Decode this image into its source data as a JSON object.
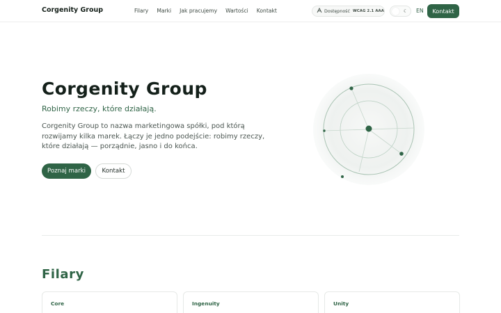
{
  "header": {
    "brand": "Corgenity Group",
    "nav": [
      "Filary",
      "Marki",
      "Jak pracujemy",
      "Wartości",
      "Kontakt"
    ],
    "accessibility_label": "Dostępność",
    "accessibility_badge": "WCAG 2.1 AAA",
    "theme_icon": "moon-icon",
    "language": "EN",
    "contact_button": "Kontakt"
  },
  "hero": {
    "title": "Corgenity Group",
    "subtitle": "Robimy rzeczy, które działają.",
    "description": "Corgenity Group to nazwa marketingowa spółki, pod którą rozwijamy kilka marek. Łączy je jedno podejście: robimy rzeczy, które działają — porządnie, jasno i do końca.",
    "primary_button": "Poznaj marki",
    "secondary_button": "Kontakt"
  },
  "section": {
    "title": "Filary",
    "cards": [
      {
        "title": "Core"
      },
      {
        "title": "Ingenuity"
      },
      {
        "title": "Unity"
      }
    ]
  },
  "colors": {
    "accent": "#2f6446",
    "background": "#ffffff",
    "text": "#14201a"
  }
}
